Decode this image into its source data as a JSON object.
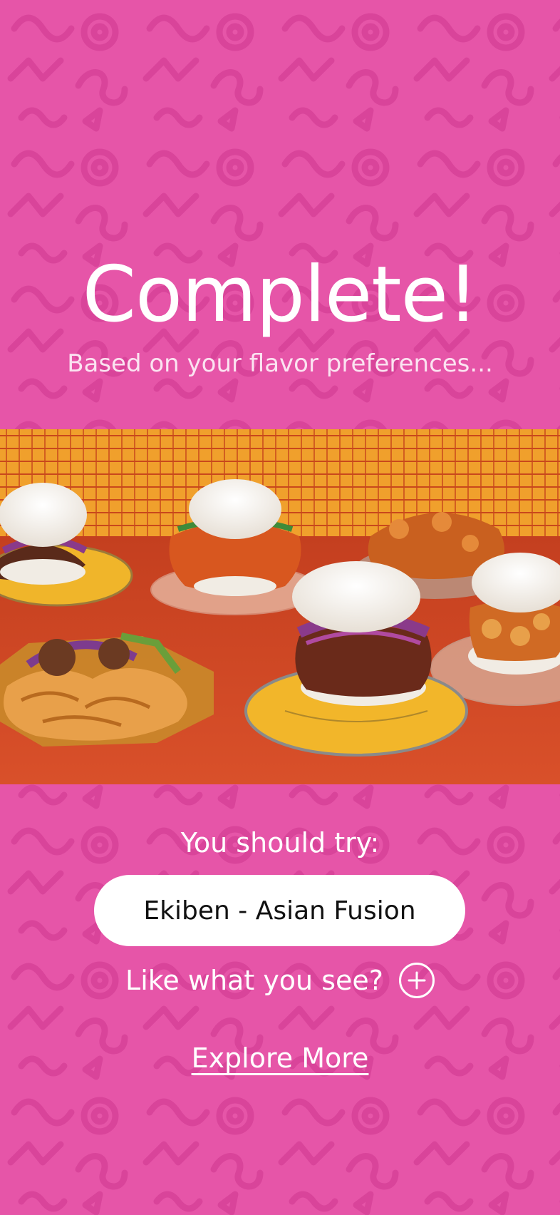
{
  "header": {
    "title": "Complete!",
    "subtitle": "Based on your flavor preferences..."
  },
  "hero": {
    "image_description_icon": "food-photo-bao-buns"
  },
  "recommendation": {
    "label": "You should try:",
    "restaurant": "Ekiben - Asian Fusion"
  },
  "feedback": {
    "prompt": "Like what you see?",
    "icon": "plus-circle-icon"
  },
  "explore": {
    "link_label": "Explore More"
  },
  "colors": {
    "background": "#e655a8",
    "pattern": "#d9449a",
    "pill": "#ffffff",
    "text": "#ffffff"
  }
}
